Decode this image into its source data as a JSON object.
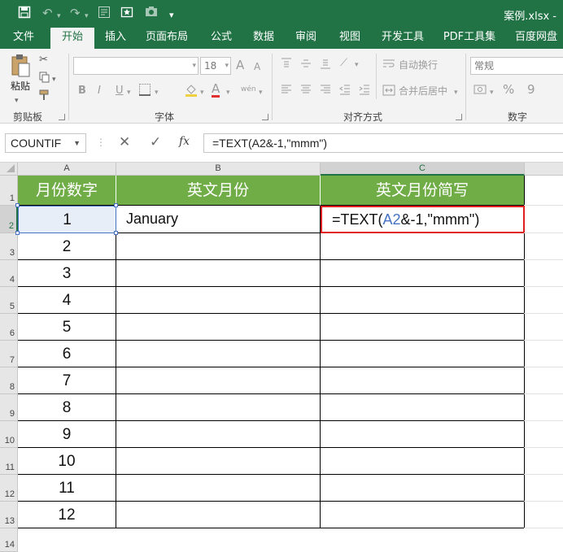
{
  "titlebar": {
    "file_title": "案例.xlsx -"
  },
  "tabs": [
    "文件",
    "开始",
    "插入",
    "页面布局",
    "公式",
    "数据",
    "审阅",
    "视图",
    "开发工具",
    "PDF工具集",
    "百度网盘"
  ],
  "ribbon": {
    "paste_label": "粘贴",
    "clipboard_label": "剪贴板",
    "font_label": "字体",
    "font_size": "18",
    "bold": "B",
    "italic": "I",
    "underline": "U",
    "grow_font": "A",
    "shrink_font": "A",
    "font_color": "A",
    "phonetic": "wén",
    "alignment_label": "对齐方式",
    "wrap_text": "自动换行",
    "merge_center": "合并后居中",
    "number_label": "数字",
    "number_format": "常规",
    "percent": "%",
    "comma": "9"
  },
  "formula_bar": {
    "name_box": "COUNTIF",
    "cancel": "✕",
    "enter": "✓",
    "fx": "fx",
    "formula": "=TEXT(A2&-1,\"mmm\")"
  },
  "columns": [
    "A",
    "B",
    "C"
  ],
  "rows": [
    "1",
    "2",
    "3",
    "4",
    "5",
    "6",
    "7",
    "8",
    "9",
    "10",
    "11",
    "12",
    "13",
    "14"
  ],
  "sheet": {
    "headers": [
      "月份数字",
      "英文月份",
      "英文月份简写"
    ],
    "a_values": [
      "1",
      "2",
      "3",
      "4",
      "5",
      "6",
      "7",
      "8",
      "9",
      "10",
      "11",
      "12"
    ],
    "b2": "January",
    "c2_parts": {
      "pre": "=TEXT(",
      "ref": "A2",
      "post": "&-1,\"mmm\")"
    }
  },
  "colors": {
    "excel_green": "#217346",
    "header_fill": "#70ad47",
    "ref_blue": "#4472c4",
    "edit_outline": "#e02020",
    "selection": "#4472c4"
  }
}
